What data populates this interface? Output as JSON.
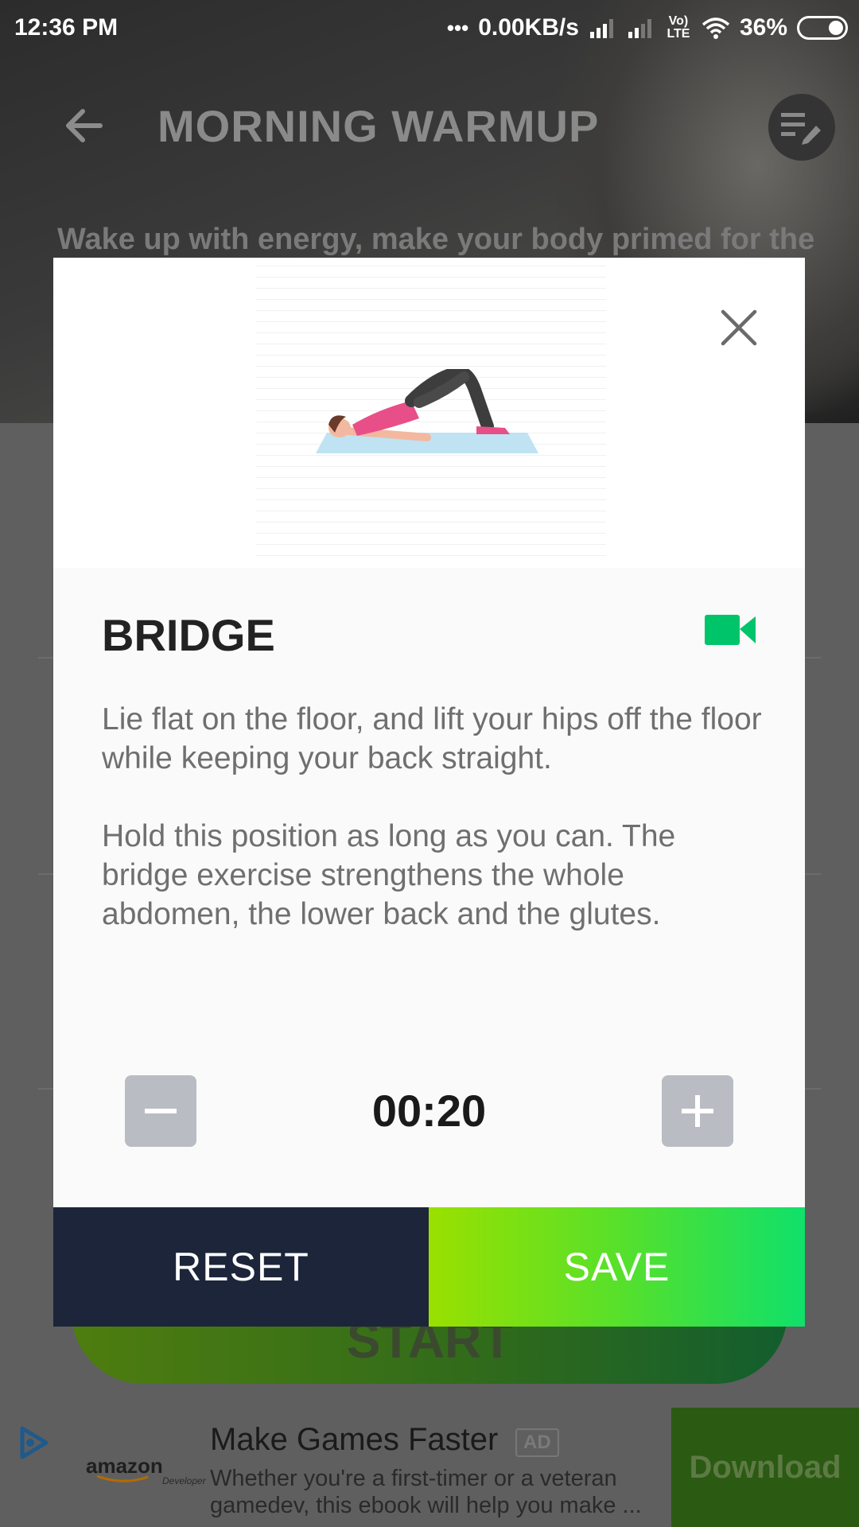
{
  "status_bar": {
    "time": "12:36 PM",
    "network_speed": "0.00KB/s",
    "network_type": "Vo) LTE",
    "battery": "36%"
  },
  "header": {
    "title": "MORNING WARMUP",
    "subtitle": "Wake up with energy, make your body primed for the"
  },
  "background": {
    "start_label": "START"
  },
  "dialog": {
    "exercise_name": "BRIDGE",
    "description_1": "Lie flat on the floor, and lift your hips off the floor while keeping your back straight.",
    "description_2": "Hold this position as long as you can. The bridge exercise strengthens the whole abdomen, the lower back and the glutes.",
    "timer": "00:20",
    "reset_label": "RESET",
    "save_label": "SAVE"
  },
  "ad": {
    "advertiser": "amazon",
    "advertiser_sub": "Developer",
    "title": "Make Games Faster",
    "badge": "AD",
    "description": "Whether you're a first-timer or a veteran gamedev, this ebook will help you make ...",
    "cta": "Download"
  },
  "colors": {
    "accent_green": "#00c46a",
    "reset_bg": "#1c253a",
    "save_gradient_start": "#9ae000",
    "save_gradient_end": "#10e06a"
  },
  "icons": [
    "back-arrow-icon",
    "edit-list-icon",
    "close-icon",
    "video-camera-icon",
    "minus-icon",
    "plus-icon",
    "ad-choices-icon"
  ]
}
